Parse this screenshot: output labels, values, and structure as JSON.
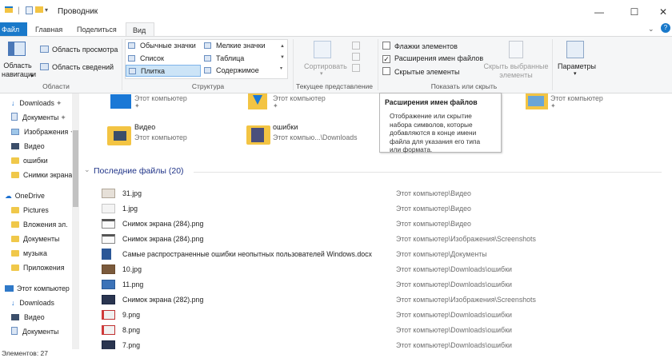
{
  "window": {
    "title": "Проводник",
    "minimize": "—",
    "maximize": "☐",
    "close": "✕",
    "help": "?"
  },
  "tabs": [
    "Файл",
    "Главная",
    "Поделиться",
    "Вид"
  ],
  "ribbon": {
    "panels": {
      "nav_pane": "Область\nнавигации",
      "preview": "Область просмотра",
      "details": "Область сведений",
      "group": "Области"
    },
    "layout": {
      "items": [
        "Обычные значки",
        "Мелкие значки",
        "Список",
        "Таблица",
        "Плитка",
        "Содержимое"
      ],
      "group": "Структура"
    },
    "current_view": {
      "sort": "Сортировать",
      "group": "Текущее представление"
    },
    "show_hide": {
      "item_checkboxes": "Флажки элементов",
      "extensions": "Расширения имен файлов",
      "hidden": "Скрытые элементы",
      "hide_selected": "Скрыть выбранные\nэлементы",
      "group": "Показать или скрыть"
    },
    "options": "Параметры"
  },
  "nav": [
    {
      "label": "Downloads",
      "pin": "✦"
    },
    {
      "label": "Документы",
      "pin": "✦"
    },
    {
      "label": "Изображения",
      "pin": "✦"
    },
    {
      "label": "Видео",
      "pin": ""
    },
    {
      "label": "ошибки",
      "pin": ""
    },
    {
      "label": "Снимки экрана",
      "pin": ""
    },
    {
      "label": "OneDrive",
      "pin": ""
    },
    {
      "label": "Pictures",
      "pin": ""
    },
    {
      "label": "Вложения эл.",
      "pin": ""
    },
    {
      "label": "Документы",
      "pin": ""
    },
    {
      "label": "музыка",
      "pin": ""
    },
    {
      "label": "Приложения",
      "pin": ""
    },
    {
      "label": "Этот компьютер",
      "pin": ""
    },
    {
      "label": "Downloads",
      "pin": ""
    },
    {
      "label": "Видео",
      "pin": ""
    },
    {
      "label": "Документы",
      "pin": ""
    }
  ],
  "frequent": [
    {
      "name": "",
      "sub": "Этот компьютер"
    },
    {
      "name": "",
      "sub": "Этот компьютер"
    },
    {
      "name": "",
      "sub": "Этот компьютер"
    },
    {
      "name": "Видео",
      "sub": "Этот компьютер"
    },
    {
      "name": "ошибки",
      "sub": "Этот компью...\\Downloads"
    }
  ],
  "tooltip": {
    "title": "Расширения имен файлов",
    "body": "Отображение или скрытие\nнабора символов, которые\nдобавляются в конце имени\nфайла для указания его типа\nили формата."
  },
  "recent_header": "Последние файлы (20)",
  "recent": [
    {
      "name": "31.jpg",
      "path": "Этот компьютер\\Видео"
    },
    {
      "name": "1.jpg",
      "path": "Этот компьютер\\Видео"
    },
    {
      "name": "Снимок экрана (284).png",
      "path": "Этот компьютер\\Видео"
    },
    {
      "name": "Снимок экрана (284).png",
      "path": "Этот компьютер\\Изображения\\Screenshots"
    },
    {
      "name": "Самые распространенные ошибки неопытных пользователей Windows.docx",
      "path": "Этот компьютер\\Документы"
    },
    {
      "name": "10.jpg",
      "path": "Этот компьютер\\Downloads\\ошибки"
    },
    {
      "name": "11.png",
      "path": "Этот компьютер\\Downloads\\ошибки"
    },
    {
      "name": "Снимок экрана (282).png",
      "path": "Этот компьютер\\Изображения\\Screenshots"
    },
    {
      "name": "9.png",
      "path": "Этот компьютер\\Downloads\\ошибки"
    },
    {
      "name": "8.png",
      "path": "Этот компьютер\\Downloads\\ошибки"
    },
    {
      "name": "7.png",
      "path": "Этот компьютер\\Downloads\\ошибки"
    }
  ],
  "status": "Элементов: 27",
  "colors": {
    "accent": "#1979ca",
    "folder": "#f3c443",
    "header": "#1e3287"
  }
}
